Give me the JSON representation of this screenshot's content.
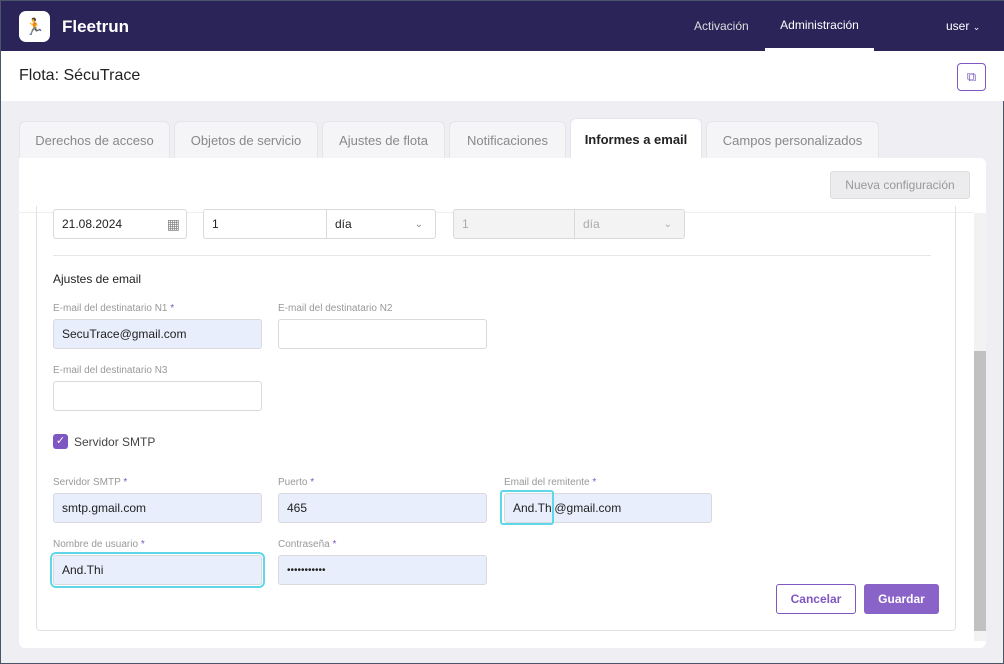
{
  "nav": {
    "brand": "Fleetrun",
    "items": [
      "Activación",
      "Administración"
    ],
    "user": "user"
  },
  "header": {
    "title": "Flota: SécuTrace"
  },
  "tabs": [
    "Derechos de acceso",
    "Objetos de servicio",
    "Ajustes de flota",
    "Notificaciones",
    "Informes a email",
    "Campos personalizados"
  ],
  "toolbar": {
    "new_config": "Nueva configuración"
  },
  "schedule": {
    "date": "21.08.2024",
    "interval": "1",
    "unit": "día",
    "interval2": "1",
    "unit2": "día"
  },
  "email": {
    "section": "Ajustes de email",
    "n1_label": "E-mail del destinatario N1",
    "n1": "SecuTrace@gmail.com",
    "n2_label": "E-mail del destinatario N2",
    "n2": "",
    "n3_label": "E-mail del destinatario N3",
    "n3": "",
    "star": "*"
  },
  "smtp": {
    "checkbox": "Servidor SMTP",
    "checked": true,
    "server_label": "Servidor SMTP",
    "server": "smtp.gmail.com",
    "port_label": "Puerto",
    "port": "465",
    "sender_label": "Email del remitente",
    "sender": "And.Thi@gmail.com",
    "user_label": "Nombre de usuario",
    "user": "And.Thi",
    "pass_label": "Contraseña",
    "pass": "•••••••••••"
  },
  "actions": {
    "cancel": "Cancelar",
    "save": "Guardar"
  }
}
